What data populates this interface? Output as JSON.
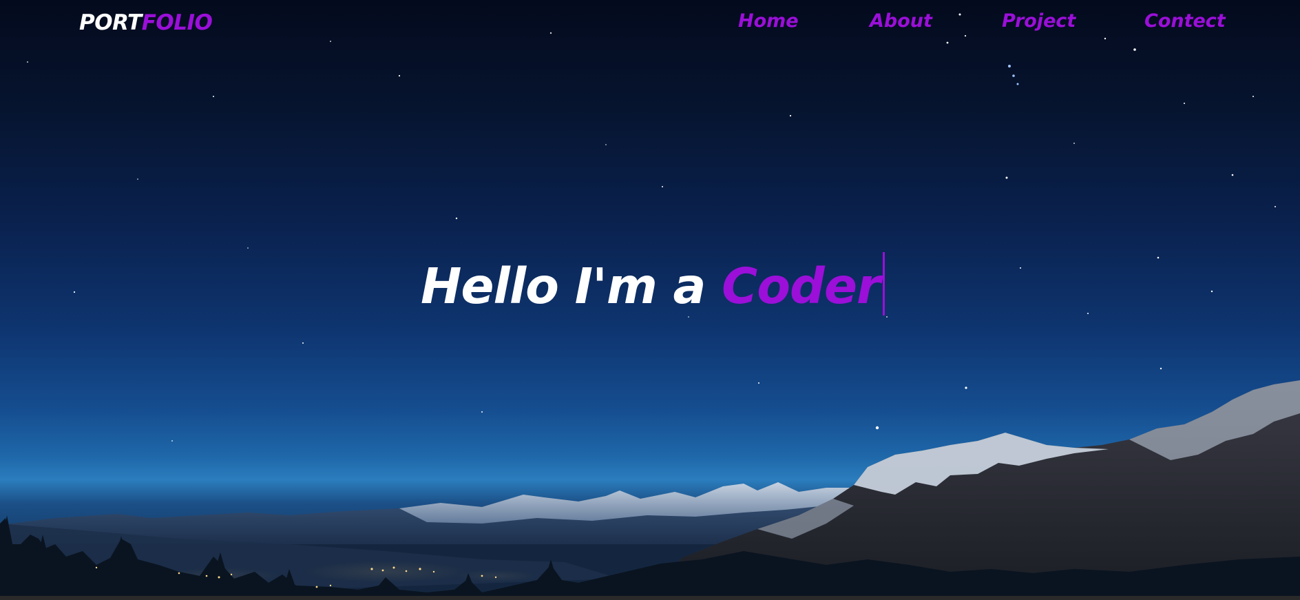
{
  "header": {
    "logo": {
      "primary": "PORT",
      "accent": "FOLIO"
    },
    "nav": [
      {
        "label": "Home"
      },
      {
        "label": "About"
      },
      {
        "label": "Project"
      },
      {
        "label": "Contect"
      }
    ]
  },
  "hero": {
    "headline_static": "Hello I'm a ",
    "headline_typed": "Coder",
    "background": "night-sky-mountain-landscape"
  },
  "colors": {
    "accent": "#9b0fd9",
    "text": "#ffffff",
    "sky_top": "#040a1d",
    "sky_horizon": "#2b7dbd"
  }
}
